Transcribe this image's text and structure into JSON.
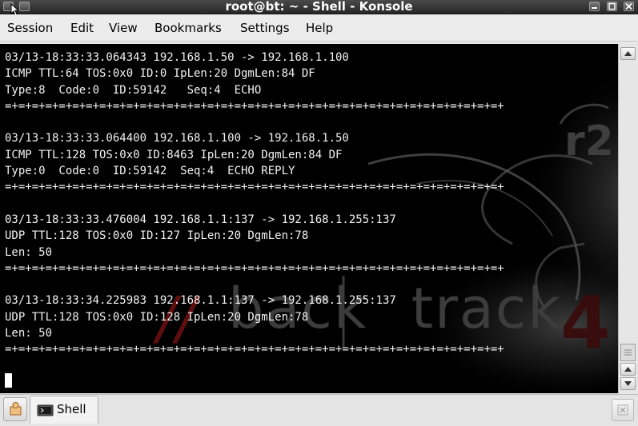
{
  "window": {
    "title": "root@bt: ~ - Shell - Konsole",
    "controls": [
      "minimize",
      "maximize",
      "close"
    ]
  },
  "menu": {
    "items": [
      "Session",
      "Edit",
      "View",
      "Bookmarks",
      "Settings",
      "Help"
    ]
  },
  "terminal": {
    "lines": [
      "03/13-18:33:33.064343 192.168.1.50 -> 192.168.1.100",
      "ICMP TTL:64 TOS:0x0 ID:0 IpLen:20 DgmLen:84 DF",
      "Type:8  Code:0  ID:59142   Seq:4  ECHO",
      "=+=+=+=+=+=+=+=+=+=+=+=+=+=+=+=+=+=+=+=+=+=+=+=+=+=+=+=+=+=+=+=+=+=+=+=+=+",
      "",
      "03/13-18:33:33.064400 192.168.1.100 -> 192.168.1.50",
      "ICMP TTL:128 TOS:0x0 ID:8463 IpLen:20 DgmLen:84 DF",
      "Type:0  Code:0  ID:59142  Seq:4  ECHO REPLY",
      "=+=+=+=+=+=+=+=+=+=+=+=+=+=+=+=+=+=+=+=+=+=+=+=+=+=+=+=+=+=+=+=+=+=+=+=+=+",
      "",
      "03/13-18:33:33.476004 192.168.1.1:137 -> 192.168.1.255:137",
      "UDP TTL:128 TOS:0x0 ID:127 IpLen:20 DgmLen:78",
      "Len: 50",
      "=+=+=+=+=+=+=+=+=+=+=+=+=+=+=+=+=+=+=+=+=+=+=+=+=+=+=+=+=+=+=+=+=+=+=+=+=+",
      "",
      "03/13-18:33:34.225983 192.168.1.1:137 -> 192.168.1.255:137",
      "UDP TTL:128 TOS:0x0 ID:128 IpLen:20 DgmLen:78",
      "Len: 50",
      "=+=+=+=+=+=+=+=+=+=+=+=+=+=+=+=+=+=+=+=+=+=+=+=+=+=+=+=+=+=+=+=+=+=+=+=+=+"
    ],
    "watermark": {
      "brand": "back",
      "brand2": "track",
      "version": "4",
      "badge": "r2"
    },
    "colors": {
      "background": "#000000",
      "text": "#f2f2f2",
      "watermark_red": "#7a1010"
    }
  },
  "tabs": {
    "items": [
      {
        "label": "Shell",
        "icon": "terminal-icon",
        "active": true
      }
    ]
  }
}
